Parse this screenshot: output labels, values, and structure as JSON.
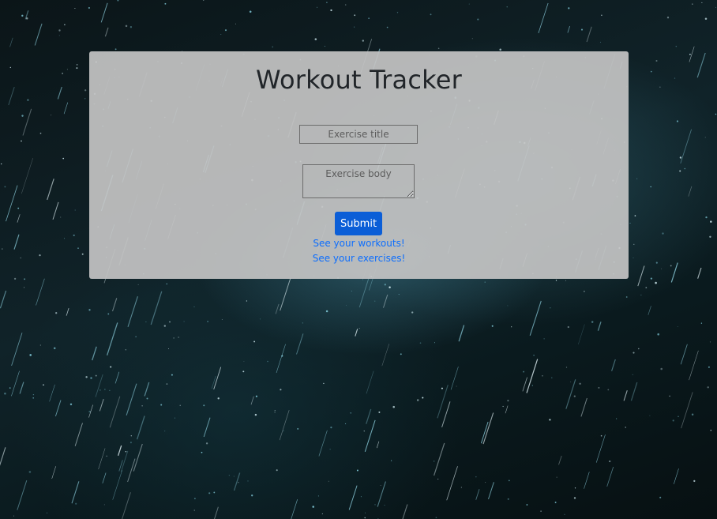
{
  "page": {
    "background": "starry-night-sky",
    "background_colors": [
      "#0a1417",
      "#102329",
      "#3c788c"
    ]
  },
  "card": {
    "title": "Workout Tracker",
    "background_color": "#c4c4c4",
    "form": {
      "title_placeholder": "Exercise title",
      "title_value": "",
      "body_placeholder": "Exercise body",
      "body_value": "",
      "submit_label": "Submit",
      "submit_color": "#0b5ed7"
    },
    "links": {
      "workouts": "See your workouts!",
      "exercises": "See your exercises!",
      "link_color": "#0d6efd"
    }
  }
}
